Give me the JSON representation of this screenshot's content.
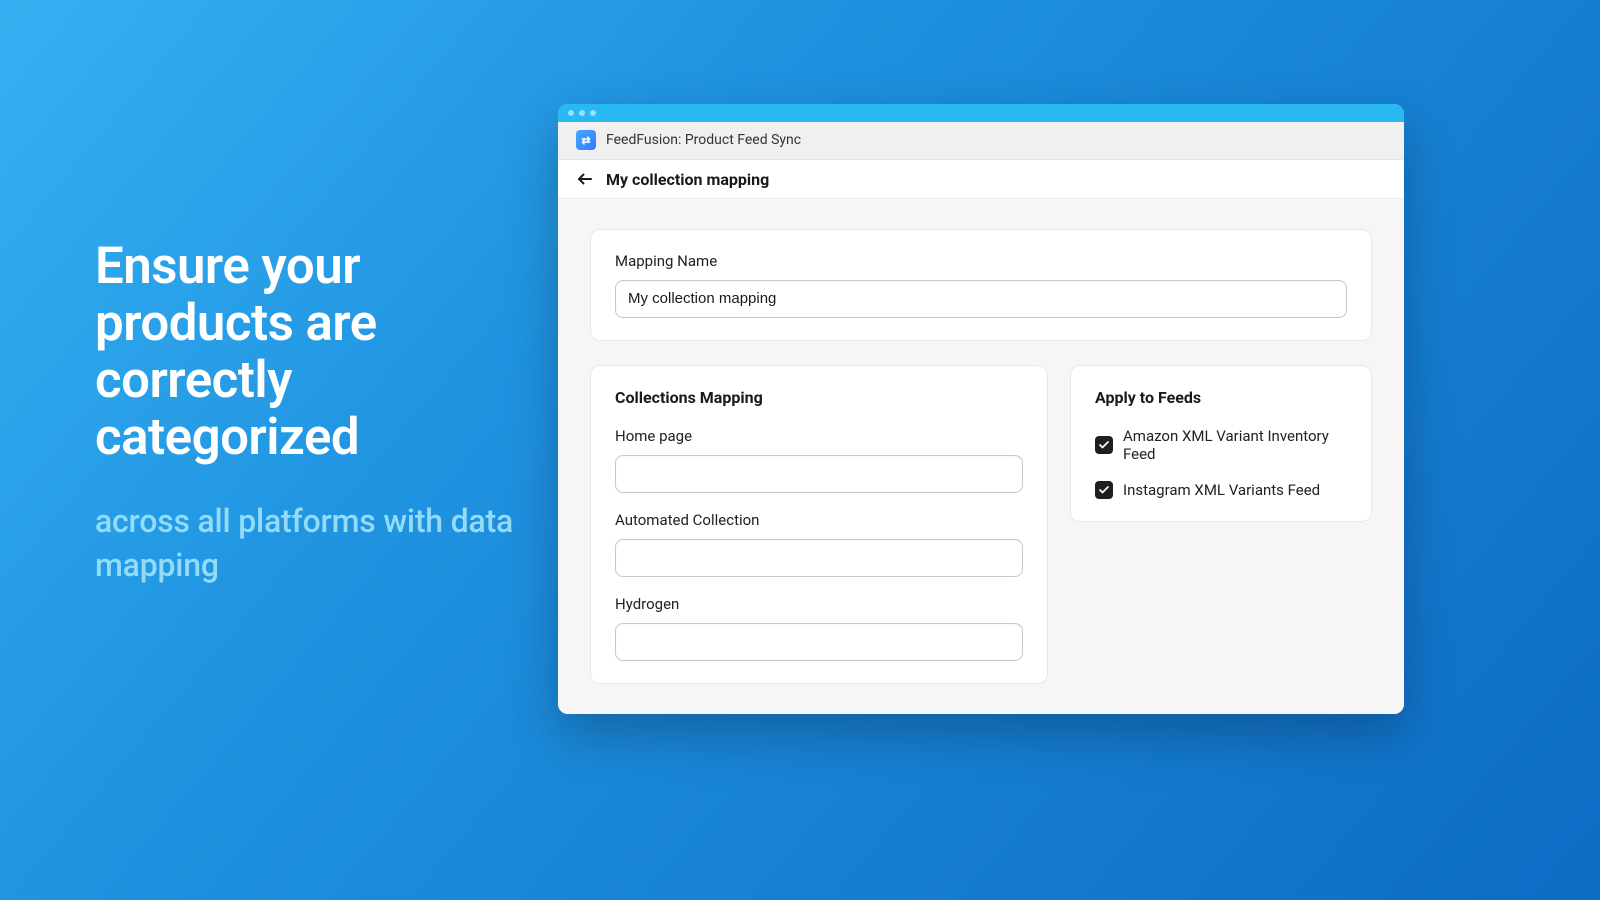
{
  "marketing": {
    "headline": "Ensure your products are correctly categorized",
    "subhead": "across all platforms with data mapping"
  },
  "app": {
    "title": "FeedFusion: Product Feed Sync"
  },
  "page": {
    "title": "My collection mapping"
  },
  "mapping_name": {
    "label": "Mapping Name",
    "value": "My collection mapping"
  },
  "collections": {
    "title": "Collections Mapping",
    "items": [
      {
        "label": "Home page",
        "value": ""
      },
      {
        "label": "Automated Collection",
        "value": ""
      },
      {
        "label": "Hydrogen",
        "value": ""
      }
    ]
  },
  "feeds": {
    "title": "Apply to Feeds",
    "items": [
      {
        "label": "Amazon XML Variant Inventory Feed",
        "checked": true
      },
      {
        "label": "Instagram XML Variants Feed",
        "checked": true
      }
    ]
  }
}
